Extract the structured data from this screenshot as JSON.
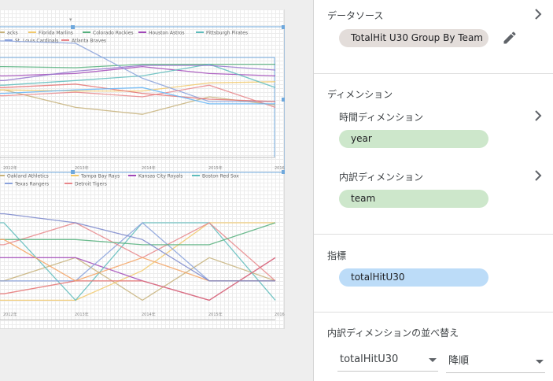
{
  "canvas": {
    "chart_top": {
      "legend": [
        {
          "label": "acks",
          "color": "#c7b27a"
        },
        {
          "label": "Florida Marlins",
          "color": "#f2c96b"
        },
        {
          "label": "Colorado Rockies",
          "color": "#55b07d"
        },
        {
          "label": "Houston Astros",
          "color": "#a149b8"
        },
        {
          "label": "Pittsburgh Pirates",
          "color": "#5ebcbc"
        },
        {
          "label": "St. Louis Cardinals",
          "color": "#8aa2dc"
        },
        {
          "label": "Atlanta Braves",
          "color": "#e8868a"
        }
      ],
      "x_ticks": [
        "2012年",
        "2013年",
        "2014年",
        "2015年",
        "2016年"
      ]
    },
    "chart_bottom": {
      "legend": [
        {
          "label": "Oakland Athletics",
          "color": "#c7b27a"
        },
        {
          "label": "Tampa Bay Rays",
          "color": "#f2c96b"
        },
        {
          "label": "Kansas City Royals",
          "color": "#a149b8"
        },
        {
          "label": "Boston Red Sox",
          "color": "#5ebcbc"
        },
        {
          "label": "Texas Rangers",
          "color": "#8aa2dc"
        },
        {
          "label": "Detroit Tigers",
          "color": "#e8868a"
        }
      ],
      "x_ticks": [
        "2012年",
        "2013年",
        "2014年",
        "2015年",
        "2016年"
      ]
    }
  },
  "panel": {
    "datasource": {
      "title": "データソース",
      "chip": "TotalHit U30 Group By Team",
      "chev_icon": "chevron-right-icon",
      "edit_icon": "pencil-icon"
    },
    "dimension": {
      "title": "ディメンション",
      "time_label": "時間ディメンション",
      "time_chip": "year",
      "breakdown_label": "内訳ディメンション",
      "breakdown_chip": "team"
    },
    "metric": {
      "title": "指標",
      "chip": "totalHitU30"
    },
    "sort": {
      "title": "内訳ディメンションの並べ替え",
      "field_value": "totalHitU30",
      "order_value": "降順"
    }
  },
  "chart_data": [
    {
      "type": "line",
      "x": [
        "2012年",
        "2013年",
        "2014年",
        "2015年",
        "2016年"
      ],
      "series": [
        {
          "name": "acks",
          "color": "#c7b27a",
          "values": [
            0.58,
            0.43,
            0.37,
            0.52,
            0.45
          ]
        },
        {
          "name": "Florida Marlins",
          "color": "#f2c96b",
          "values": [
            0.58,
            0.57,
            0.57,
            0.64,
            0.65
          ]
        },
        {
          "name": "Colorado Rockies",
          "color": "#55b07d",
          "values": [
            0.78,
            0.77,
            0.8,
            0.8,
            0.8
          ]
        },
        {
          "name": "Houston Astros",
          "color": "#a149b8",
          "values": [
            0.7,
            0.72,
            0.78,
            0.72,
            0.7
          ]
        },
        {
          "name": "Pittsburgh Pirates",
          "color": "#5ebcbc",
          "values": [
            0.62,
            0.66,
            0.7,
            0.8,
            0.6
          ]
        },
        {
          "name": "St. Louis Cardinals",
          "color": "#8aa2dc",
          "values": [
            1.0,
            0.98,
            0.68,
            0.48,
            0.48
          ]
        },
        {
          "name": "Atlanta Braves",
          "color": "#e8868a",
          "values": [
            0.53,
            0.56,
            0.52,
            0.62,
            0.43
          ]
        },
        {
          "name": "",
          "color": "#9575cd",
          "values": [
            0.66,
            0.74,
            0.79,
            0.79,
            0.75
          ]
        },
        {
          "name": "",
          "color": "#e57373",
          "values": [
            0.6,
            0.63,
            0.55,
            0.5,
            0.48
          ]
        },
        {
          "name": "",
          "color": "#64b5f6",
          "values": [
            0.55,
            0.58,
            0.6,
            0.46,
            0.46
          ]
        }
      ]
    },
    {
      "type": "line",
      "x": [
        "2012年",
        "2013年",
        "2014年",
        "2015年",
        "2016年"
      ],
      "series": [
        {
          "name": "Oakland Athletics",
          "color": "#c7b27a",
          "values": [
            0.3,
            0.48,
            0.15,
            0.48,
            0.3
          ]
        },
        {
          "name": "Tampa Bay Rays",
          "color": "#f2c96b",
          "values": [
            0.15,
            0.15,
            0.38,
            0.75,
            0.75
          ]
        },
        {
          "name": "Kansas City Royals",
          "color": "#a149b8",
          "values": [
            0.48,
            0.48,
            0.3,
            0.15,
            0.48
          ]
        },
        {
          "name": "Boston Red Sox",
          "color": "#5ebcbc",
          "values": [
            0.75,
            0.15,
            0.75,
            0.75,
            0.15
          ]
        },
        {
          "name": "Texas Rangers",
          "color": "#8aa2dc",
          "values": [
            0.3,
            0.3,
            0.75,
            0.3,
            0.3
          ]
        },
        {
          "name": "Detroit Tigers",
          "color": "#e8868a",
          "values": [
            0.58,
            0.75,
            0.48,
            0.75,
            0.3
          ]
        },
        {
          "name": "",
          "color": "#55b07d",
          "values": [
            0.62,
            0.62,
            0.58,
            0.58,
            0.75
          ]
        },
        {
          "name": "",
          "color": "#e57373",
          "values": [
            0.2,
            0.3,
            0.3,
            0.15,
            0.48
          ]
        },
        {
          "name": "",
          "color": "#f4a261",
          "values": [
            0.62,
            0.3,
            0.48,
            0.3,
            0.3
          ]
        },
        {
          "name": "",
          "color": "#7986cb",
          "values": [
            0.82,
            0.75,
            0.62,
            0.3,
            0.3
          ]
        }
      ]
    }
  ]
}
